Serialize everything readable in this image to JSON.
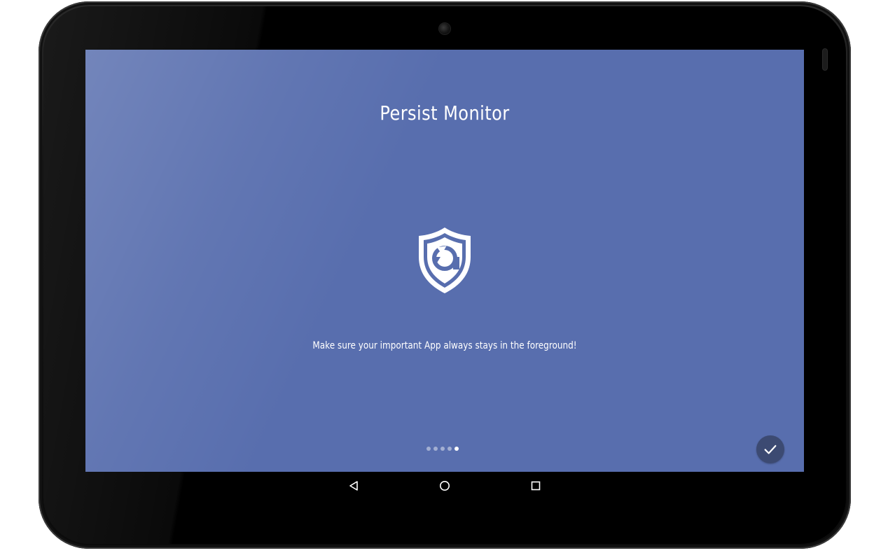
{
  "app": {
    "title": "Persist Monitor",
    "description": "Make sure your important App always stays in the foreground!"
  },
  "onboarding": {
    "page_count": 5,
    "current_page": 5,
    "done_icon": "check-icon"
  },
  "navigation": {
    "back_icon": "back-icon",
    "home_icon": "home-icon",
    "recents_icon": "recents-icon"
  },
  "colors": {
    "screen_background": "#586eae",
    "done_button": "#3c4a72",
    "text": "#ffffff"
  }
}
